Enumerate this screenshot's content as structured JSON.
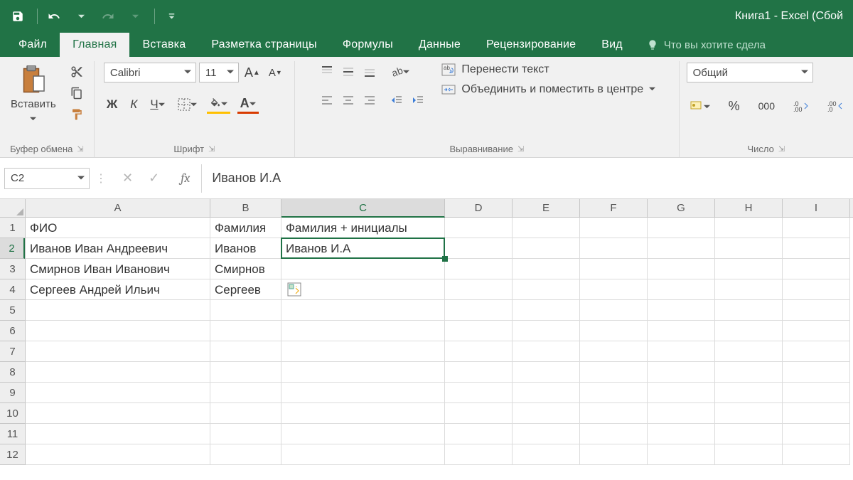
{
  "titlebar": {
    "title": "Книга1 - Excel (Сбой"
  },
  "tabs": {
    "file": "Файл",
    "home": "Главная",
    "insert": "Вставка",
    "layout": "Разметка страницы",
    "formulas": "Формулы",
    "data": "Данные",
    "review": "Рецензирование",
    "view": "Вид",
    "tellme": "Что вы хотите сдела"
  },
  "ribbon": {
    "clipboard": {
      "paste": "Вставить",
      "label": "Буфер обмена"
    },
    "font": {
      "name": "Calibri",
      "size": "11",
      "bold": "Ж",
      "italic": "К",
      "underline": "Ч",
      "label": "Шрифт"
    },
    "alignment": {
      "wrap": "Перенести текст",
      "merge": "Объединить и поместить в центре",
      "label": "Выравнивание"
    },
    "number": {
      "format": "Общий",
      "pct": "%",
      "comma": "000",
      "label": "Число"
    }
  },
  "formula_bar": {
    "cellref": "C2",
    "fx": "fx",
    "value": "Иванов И.А"
  },
  "grid": {
    "columns": [
      "A",
      "B",
      "C",
      "D",
      "E",
      "F",
      "G",
      "H",
      "I"
    ],
    "selected_col": "C",
    "selected_row": 2,
    "row_count": 12,
    "rows": [
      {
        "A": "ФИО",
        "B": "Фамилия",
        "C": "Фамилия + инициалы"
      },
      {
        "A": "Иванов Иван Андреевич",
        "B": "Иванов",
        "C": "Иванов И.А"
      },
      {
        "A": "Смирнов Иван Иванович",
        "B": "Смирнов",
        "C": ""
      },
      {
        "A": "Сергеев Андрей Ильич",
        "B": "Сергеев",
        "C": ""
      }
    ]
  }
}
